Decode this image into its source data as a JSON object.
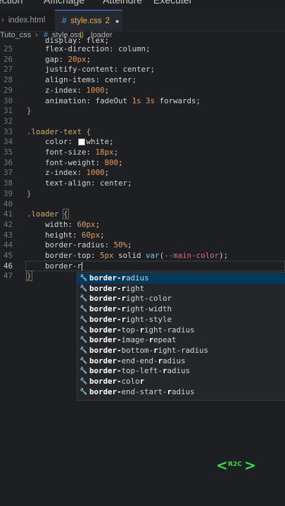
{
  "menubar": {
    "items": [
      "ection",
      "Affichage",
      "Atteindre",
      "Exécuter"
    ]
  },
  "tabs": [
    {
      "icon": "html-icon",
      "label": "index.html"
    },
    {
      "icon": "#",
      "label": "style.css",
      "badge": "2",
      "dirty": "●"
    }
  ],
  "breadcrumb": {
    "folder": "Tuto_css",
    "sep": "›",
    "file_icon": "#",
    "file": "style.css",
    "symbol_icon": "{}",
    "symbol": ".loader"
  },
  "editor": {
    "lines": [
      {
        "num": "25",
        "tokens": [
          [
            "prop",
            "    flex-direction: "
          ],
          [
            "prop",
            "column"
          ],
          [
            "punct",
            ";"
          ]
        ]
      },
      {
        "num": "26",
        "tokens": [
          [
            "prop",
            "    gap: "
          ],
          [
            "num",
            "20px"
          ],
          [
            "punct",
            ";"
          ]
        ]
      },
      {
        "num": "27",
        "tokens": [
          [
            "prop",
            "    justify-content: center;"
          ]
        ]
      },
      {
        "num": "28",
        "tokens": [
          [
            "prop",
            "    align-items: center;"
          ]
        ]
      },
      {
        "num": "29",
        "tokens": [
          [
            "prop",
            "    z-index: "
          ],
          [
            "num",
            "1000"
          ],
          [
            "punct",
            ";"
          ]
        ]
      },
      {
        "num": "30",
        "tokens": [
          [
            "prop",
            "    animation: fadeOut "
          ],
          [
            "num",
            "1s 3s"
          ],
          [
            "prop",
            " forwards;"
          ]
        ]
      },
      {
        "num": "31",
        "tokens": [
          [
            "sel",
            "}"
          ]
        ]
      },
      {
        "num": "32",
        "tokens": []
      },
      {
        "num": "33",
        "tokens": [
          [
            "sel",
            ".loader-text {"
          ]
        ]
      },
      {
        "num": "34",
        "tokens": [
          [
            "prop",
            "    color: "
          ],
          [
            "swatch",
            ""
          ],
          [
            "prop",
            "white;"
          ]
        ]
      },
      {
        "num": "35",
        "tokens": [
          [
            "prop",
            "    font-size: "
          ],
          [
            "num",
            "18px"
          ],
          [
            "punct",
            ";"
          ]
        ]
      },
      {
        "num": "36",
        "tokens": [
          [
            "prop",
            "    font-weight: "
          ],
          [
            "num",
            "800"
          ],
          [
            "punct",
            ";"
          ]
        ]
      },
      {
        "num": "37",
        "tokens": [
          [
            "prop",
            "    z-index: "
          ],
          [
            "num",
            "1000"
          ],
          [
            "punct",
            ";"
          ]
        ]
      },
      {
        "num": "38",
        "tokens": [
          [
            "prop",
            "    text-align: center;"
          ]
        ]
      },
      {
        "num": "39",
        "tokens": [
          [
            "sel",
            "}"
          ]
        ]
      },
      {
        "num": "40",
        "tokens": []
      },
      {
        "num": "41",
        "tokens": [
          [
            "sel",
            ".loader "
          ],
          [
            "brace",
            "{"
          ]
        ]
      },
      {
        "num": "42",
        "tokens": [
          [
            "prop",
            "    width: "
          ],
          [
            "num",
            "60px"
          ],
          [
            "punct",
            ";"
          ]
        ]
      },
      {
        "num": "43",
        "tokens": [
          [
            "prop",
            "    height: "
          ],
          [
            "num",
            "60px"
          ],
          [
            "punct",
            ";"
          ]
        ]
      },
      {
        "num": "44",
        "tokens": [
          [
            "prop",
            "    border-radius: "
          ],
          [
            "num",
            "50%"
          ],
          [
            "punct",
            ";"
          ]
        ]
      },
      {
        "num": "45",
        "tokens": [
          [
            "prop",
            "    border-top: "
          ],
          [
            "num",
            "5px"
          ],
          [
            "prop",
            " solid "
          ],
          [
            "func",
            "var"
          ],
          [
            "punct",
            "("
          ],
          [
            "var",
            "--main-color"
          ],
          [
            "punct",
            ");"
          ]
        ]
      },
      {
        "num": "46",
        "tokens": [
          [
            "prop",
            "    border-r"
          ],
          [
            "cursor",
            ""
          ]
        ],
        "current": true
      },
      {
        "num": "47",
        "tokens": [
          [
            "brace",
            "}"
          ]
        ]
      }
    ],
    "partial_first_line": "    display: flex;"
  },
  "suggestions": {
    "query_prefix": "border-",
    "items": [
      {
        "pre": "border-",
        "b1": "r",
        "mid": "adius",
        "selected": true
      },
      {
        "pre": "border-",
        "b1": "r",
        "mid": "ight"
      },
      {
        "pre": "border-",
        "b1": "r",
        "mid": "ight-color"
      },
      {
        "pre": "border-",
        "b1": "r",
        "mid": "ight-width"
      },
      {
        "pre": "border-",
        "b1": "r",
        "mid": "ight-style"
      },
      {
        "pre": "border-",
        "b1": "",
        "mid": "top-",
        "b2": "r",
        "post": "ight-radius"
      },
      {
        "pre": "border-",
        "b1": "",
        "mid": "image-",
        "b2": "r",
        "post": "epeat"
      },
      {
        "pre": "border-",
        "b1": "",
        "mid": "bottom-",
        "b2": "r",
        "post": "ight-radius"
      },
      {
        "pre": "border-",
        "b1": "",
        "mid": "end-end-",
        "b2": "r",
        "post": "adius"
      },
      {
        "pre": "border-",
        "b1": "",
        "mid": "top-left-",
        "b2": "r",
        "post": "adius"
      },
      {
        "pre": "border-",
        "b1": "",
        "mid": "colo",
        "b2": "r",
        "post": ""
      },
      {
        "pre": "border-",
        "b1": "",
        "mid": "end-start-",
        "b2": "r",
        "post": "adius"
      }
    ]
  },
  "watermark": {
    "text": "R2C",
    "color": "#39d94a"
  }
}
